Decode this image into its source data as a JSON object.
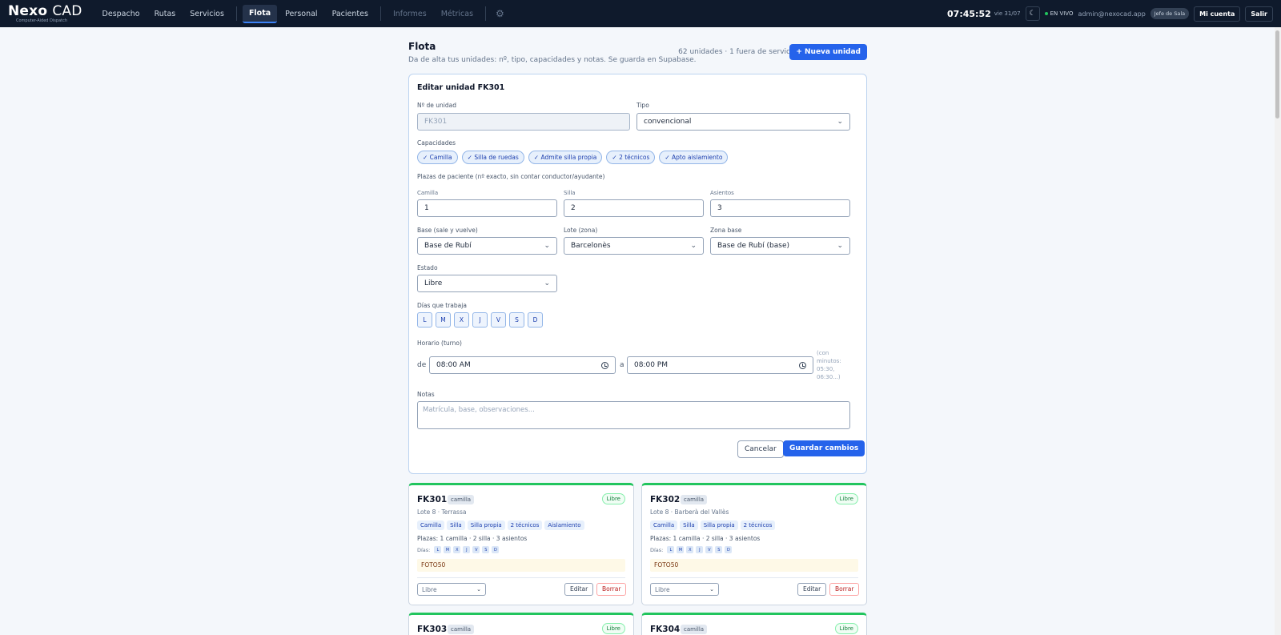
{
  "topbar": {
    "logo_main": "Nexo",
    "logo_cad": "CAD",
    "logo_sub": "Computer-Aided Dispatch",
    "nav": [
      {
        "label": "Despacho"
      },
      {
        "label": "Rutas"
      },
      {
        "label": "Servicios"
      },
      {
        "label": "Flota"
      },
      {
        "label": "Personal"
      },
      {
        "label": "Pacientes"
      },
      {
        "label": "Informes"
      },
      {
        "label": "Métricas"
      }
    ],
    "gear_icon": "⚙",
    "clock": "07:45:52",
    "date": "vie 31/07",
    "theme_icon": "☾",
    "live": "EN VIVO",
    "email": "admin@nexocad.app",
    "role": "Jefe de Sala",
    "account": "Mi cuenta",
    "logout": "Salir"
  },
  "page": {
    "title": "Flota",
    "subtitle": "Da de alta tus unidades: nº, tipo, capacidades y notas. Se guarda en Supabase.",
    "unit_count": "62 unidades · 1 fuera de servicio",
    "new_unit": "+ Nueva unidad"
  },
  "form": {
    "title": "Editar unidad FK301",
    "unit_no_label": "Nº de unidad",
    "unit_no_value": "FK301",
    "type_label": "Tipo",
    "type_value": "convencional",
    "caps_label": "Capacidades",
    "caps": [
      "✓ Camilla",
      "✓ Silla de ruedas",
      "✓ Admite silla propia",
      "✓ 2 técnicos",
      "✓ Apto aislamiento"
    ],
    "seats_label": "Plazas de paciente (nº exacto, sin contar conductor/ayudante)",
    "stretcher_label": "Camilla",
    "stretcher_value": "1",
    "chair_label": "Silla",
    "chair_value": "2",
    "seats_sub_label": "Asientos",
    "seats_value": "3",
    "base_label": "Base (sale y vuelve)",
    "base_value": "Base de Rubí",
    "lot_label": "Lote (zona)",
    "lot_value": "Barcelonès",
    "zone_label": "Zona base",
    "zone_value": "Base de Rubí (base)",
    "status_label": "Estado",
    "status_value": "Libre",
    "days_label": "Días que trabaja",
    "days": [
      "L",
      "M",
      "X",
      "J",
      "V",
      "S",
      "D"
    ],
    "schedule_label": "Horario (turno)",
    "from_label": "de",
    "from_value": "08:00 AM",
    "to_label": "a",
    "to_value": "08:00 PM",
    "schedule_hint": "(con minutos: 05:30, 06:30...)",
    "notes_label": "Notas",
    "notes_placeholder": "Matrícula, base, observaciones...",
    "cancel": "Cancelar",
    "save": "Guardar cambios"
  },
  "units": [
    {
      "id": "FK301",
      "type": "camilla",
      "status": "Libre",
      "location": "Lote 8 · Terrassa",
      "tags": [
        "Camilla",
        "Silla",
        "Silla propia",
        "2 técnicos",
        "Aislamiento"
      ],
      "plazas": "Plazas: 1 camilla · 2 silla · 3 asientos",
      "days_label": "Días:",
      "days": [
        "L",
        "M",
        "X",
        "J",
        "V",
        "S",
        "D"
      ],
      "note": "FOTO50",
      "select_value": "Libre",
      "edit": "Editar",
      "delete": "Borrar"
    },
    {
      "id": "FK302",
      "type": "camilla",
      "status": "Libre",
      "location": "Lote 8 · Barberà del Vallès",
      "tags": [
        "Camilla",
        "Silla",
        "Silla propia",
        "2 técnicos"
      ],
      "plazas": "Plazas: 1 camilla · 2 silla · 3 asientos",
      "days_label": "Días:",
      "days": [
        "L",
        "M",
        "X",
        "J",
        "V",
        "S",
        "D"
      ],
      "note": "FOTO50",
      "select_value": "Libre",
      "edit": "Editar",
      "delete": "Borrar"
    },
    {
      "id": "FK303",
      "type": "camilla",
      "status": "Libre"
    },
    {
      "id": "FK304",
      "type": "camilla",
      "status": "Libre"
    }
  ]
}
